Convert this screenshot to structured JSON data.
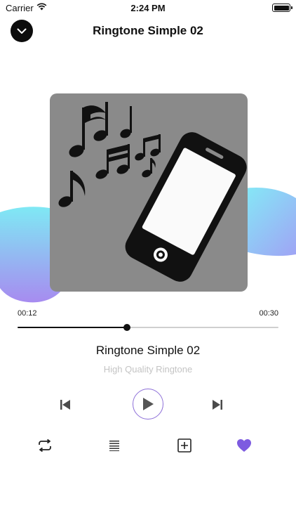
{
  "status_bar": {
    "carrier": "Carrier",
    "time": "2:24 PM"
  },
  "nav": {
    "title": "Ringtone Simple 02",
    "collapse_icon": "chevron-down-icon"
  },
  "player": {
    "artwork_icon": "music-notes-phone-illustration",
    "current_time": "00:12",
    "total_time": "00:30",
    "progress": 0.42,
    "track_title": "Ringtone Simple 02",
    "track_subtitle": "High Quality Ringtone",
    "is_favorite": true
  },
  "controls": {
    "previous_icon": "skip-previous-icon",
    "play_icon": "play-icon",
    "next_icon": "skip-next-icon"
  },
  "actions": {
    "repeat_icon": "repeat-icon",
    "list_icon": "list-icon",
    "add_icon": "add-square-icon",
    "favorite_icon": "heart-icon"
  },
  "colors": {
    "accent": "#8d6fd8",
    "heart": "#7d5be0",
    "blob_gradient_start": "#7fe9f4",
    "blob_gradient_end": "#a78bf0",
    "artwork_bg": "#8a8a8a"
  }
}
